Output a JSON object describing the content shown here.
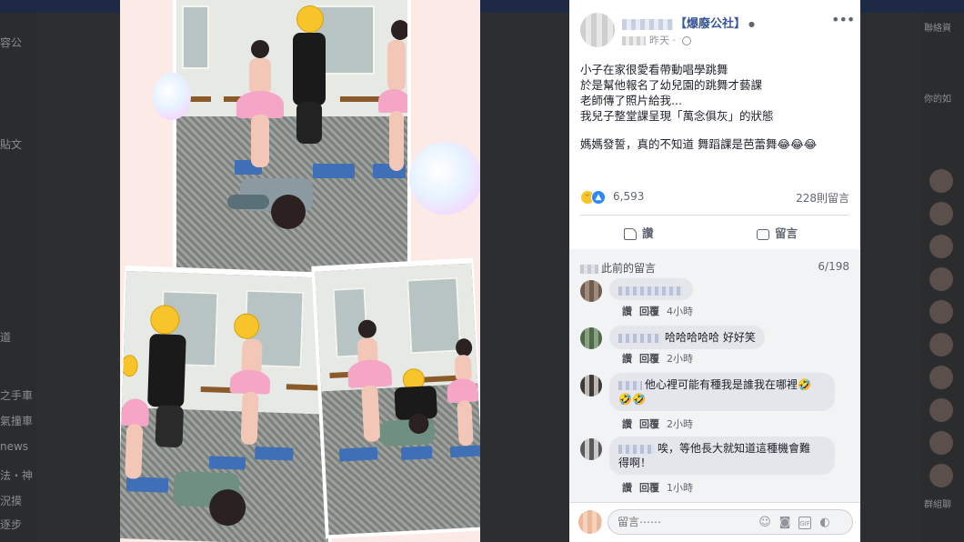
{
  "background": {
    "left_texts": [
      "容公",
      "貼文",
      "道",
      "之手車",
      "氣撞車",
      "news",
      "法・神",
      "況摸",
      "逐步"
    ],
    "right_texts": [
      "聯絡資",
      "你的如",
      "群組聊"
    ]
  },
  "photo": {
    "alt": "幼兒園芭蕾舞課照片拼貼"
  },
  "post": {
    "author": "【爆廢公社】",
    "time": "昨天",
    "more_icon": "more-horizontal-icon",
    "lines": [
      "小子在家很愛看帶動唱學跳舞",
      "於是幫他報名了幼兒園的跳舞才藝課",
      "老師傳了照片給我...",
      "我兒子整堂課呈現「萬念俱灰」的狀態"
    ],
    "line5": "媽媽發誓，真的不知道 舞蹈課是芭蕾舞😂😂😂",
    "reactions_count": "6,593",
    "comments_count": "228則留言",
    "like_label": "讚",
    "comment_label": "留言"
  },
  "comments": {
    "prev_label": "此前的留言",
    "prev_count": "6/198",
    "items": [
      {
        "text": "",
        "like": "讚",
        "reply": "回覆",
        "time": "4小時"
      },
      {
        "text": "哈哈哈哈哈 好好笑",
        "like": "讚",
        "reply": "回覆",
        "time": "2小時"
      },
      {
        "text": "他心裡可能有種我是誰我在哪裡🤣",
        "text2": "🤣🤣",
        "like": "讚",
        "reply": "回覆",
        "time": "2小時"
      },
      {
        "text": "唉，等他長大就知道這種機會難",
        "text2": "得啊！",
        "like": "讚",
        "reply": "回覆",
        "time": "1小時"
      }
    ]
  },
  "composer": {
    "placeholder": "留言⋯⋯",
    "icons": [
      "emoji-icon",
      "camera-icon",
      "gif-icon",
      "sticker-icon"
    ]
  },
  "colors": {
    "link": "#385898",
    "accent": "#2d88ff",
    "panel_bg": "#ffffff",
    "comment_bg": "#f2f3f5"
  }
}
